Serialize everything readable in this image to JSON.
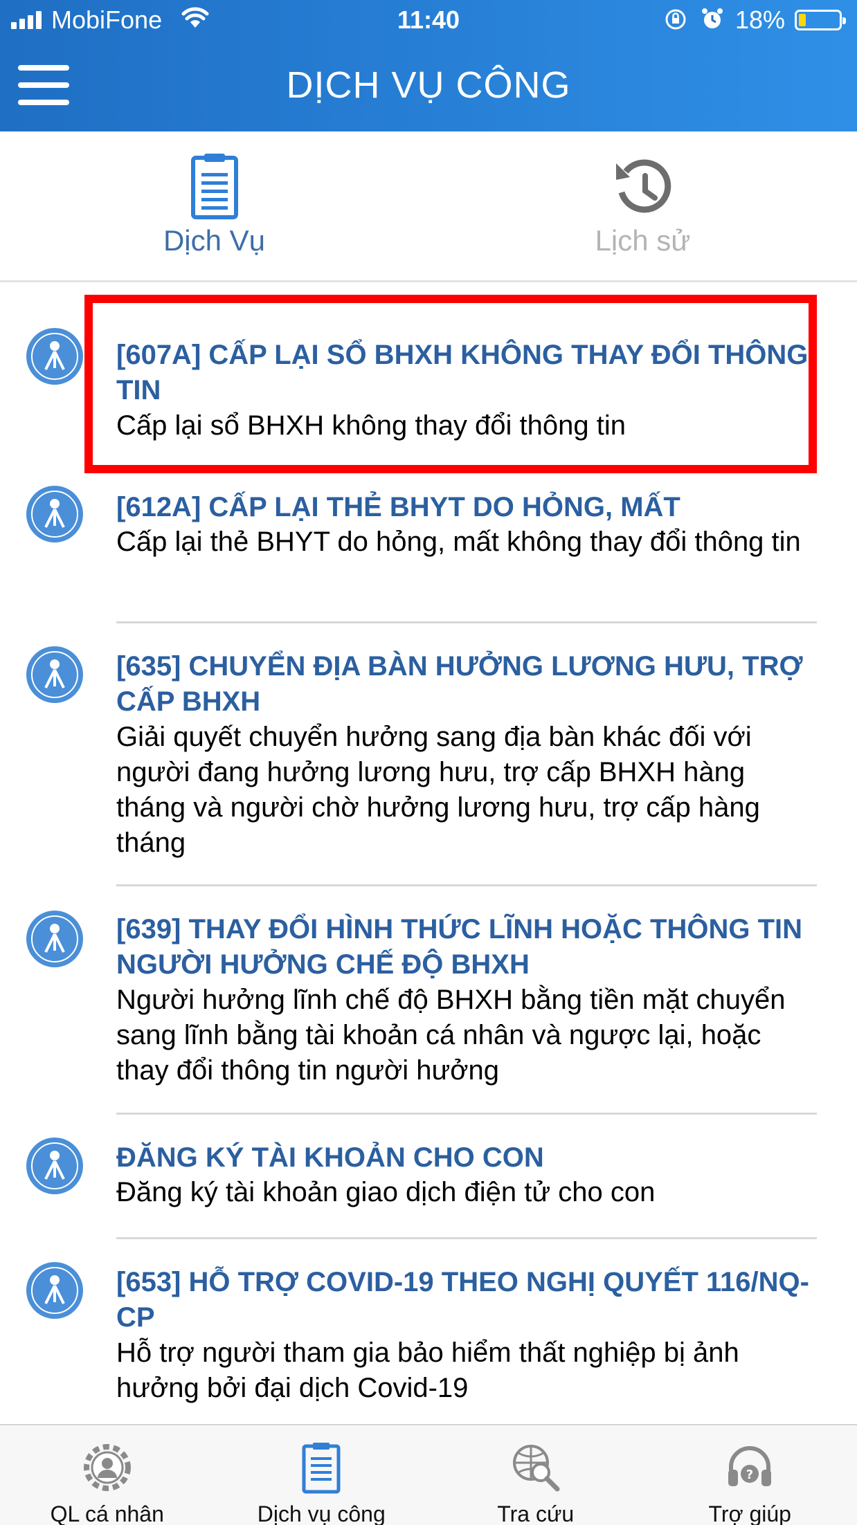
{
  "status_bar": {
    "carrier": "MobiFone",
    "time": "11:40",
    "battery_percent_label": "18%",
    "battery_level": 0.18
  },
  "header": {
    "title": "DỊCH VỤ CÔNG",
    "menu_icon": "hamburger-menu-icon"
  },
  "tabs": [
    {
      "label": "Dịch Vụ",
      "icon": "document-list-icon",
      "active": true
    },
    {
      "label": "Lịch sử",
      "icon": "history-icon",
      "active": false
    }
  ],
  "services": [
    {
      "title": "[607A] CẤP LẠI SỔ BHXH KHÔNG THAY ĐỔI THÔNG TIN",
      "description": "Cấp lại sổ BHXH không thay đổi thông tin",
      "highlighted": true
    },
    {
      "title": "[612A] CẤP LẠI THẺ BHYT DO HỎNG, MẤT",
      "description": "Cấp lại thẻ BHYT do hỏng, mất không thay đổi thông tin"
    },
    {
      "title": "[635] CHUYỂN ĐỊA BÀN HƯỞNG LƯƠNG HƯU, TRỢ CẤP BHXH",
      "description": "Giải quyết chuyển hưởng sang địa bàn khác đối với người đang hưởng lương hưu, trợ cấp BHXH hàng tháng và người chờ hưởng lương hưu, trợ cấp hàng tháng"
    },
    {
      "title": "[639] THAY ĐỔI HÌNH THỨC LĨNH HOẶC THÔNG TIN NGƯỜI HƯỞNG CHẾ ĐỘ BHXH",
      "description": "Người hưởng lĩnh chế độ BHXH bằng tiền mặt chuyển sang lĩnh bằng tài khoản cá nhân và ngược lại, hoặc thay đổi thông tin người hưởng"
    },
    {
      "title": "ĐĂNG KÝ TÀI KHOẢN CHO CON",
      "description": "Đăng ký tài khoản giao dịch điện tử cho con"
    },
    {
      "title": "[653] HỖ TRỢ COVID-19 THEO NGHỊ QUYẾT 116/NQ-CP",
      "description": "Hỗ trợ người tham gia bảo hiểm thất nghiệp bị ảnh hưởng bởi đại dịch Covid-19"
    }
  ],
  "bottom_nav": [
    {
      "label": "QL cá nhân",
      "icon": "gear-person-icon"
    },
    {
      "label": "Dịch vụ công",
      "icon": "document-list-icon",
      "active": true
    },
    {
      "label": "Tra cứu",
      "icon": "globe-search-icon"
    },
    {
      "label": "Trợ giúp",
      "icon": "headset-help-icon"
    }
  ],
  "colors": {
    "header_gradient_start": "#1f6fc4",
    "header_gradient_end": "#2f8fe6",
    "title_blue": "#2b5fa0",
    "highlight_red": "#ff0000",
    "active_tab": "#3e6da8",
    "inactive_tab": "#b4b4b4"
  }
}
